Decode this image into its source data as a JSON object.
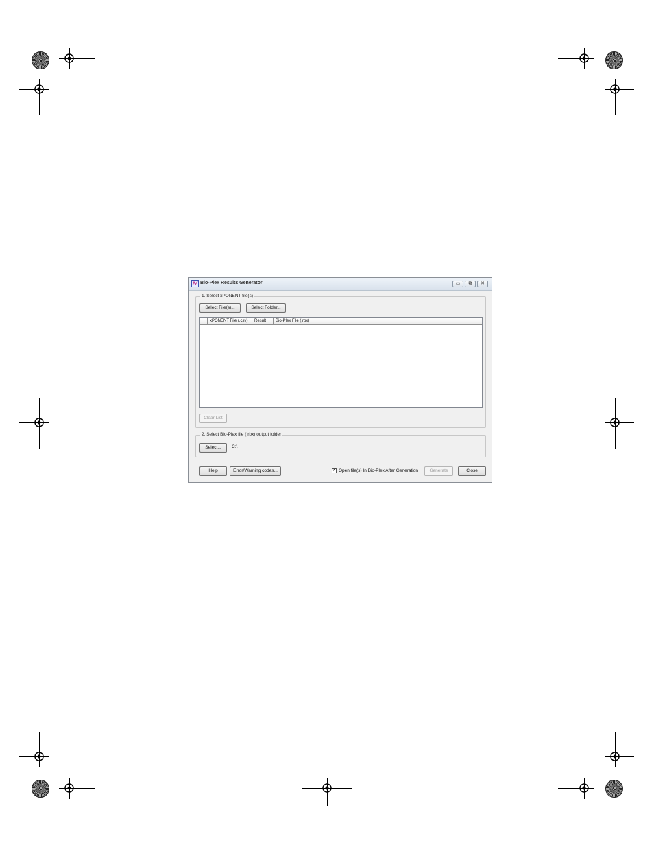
{
  "window": {
    "title": "Bio-Plex Results Generator",
    "minimize": "▭",
    "restore": "⧉",
    "close": "✕"
  },
  "section1": {
    "label": "1. Select xPONENT file(s)",
    "select_files": "Select File(s)...",
    "select_folder": "Select Folder...",
    "columns": [
      "",
      "xPONENT File (.csv)",
      "Result",
      "Bio-Plex File (.rbx)"
    ],
    "clear_list": "Clear List"
  },
  "section2": {
    "label": "2. Select Bio-Plex file (.rbx) output folder",
    "select": "Select...",
    "path": "C:\\"
  },
  "footer": {
    "help": "Help",
    "error_codes": "Error/Warning codes...",
    "open_after": "Open file(s) In Bio-Plex After Generation",
    "open_after_checked": true,
    "generate": "Generate",
    "close": "Close"
  }
}
